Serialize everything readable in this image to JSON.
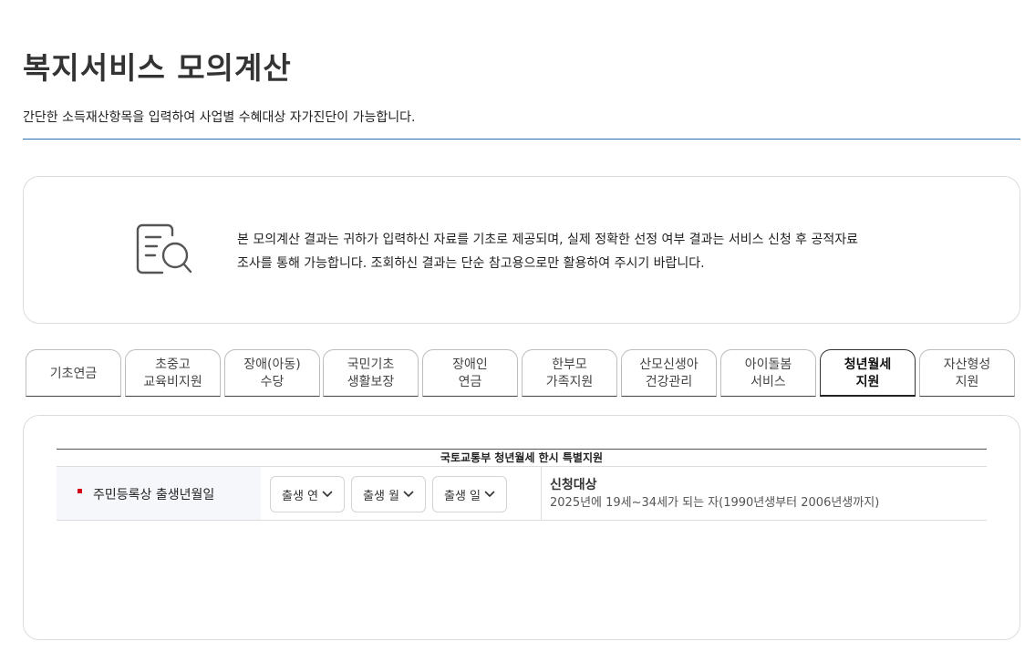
{
  "header": {
    "title": "복지서비스 모의계산",
    "description": "간단한 소득재산항목을 입력하여 사업별 수혜대상 자가진단이 가능합니다."
  },
  "notice": {
    "line1": "본 모의계산 결과는 귀하가 입력하신 자료를 기초로 제공되며, 실제 정확한 선정 여부 결과는 서비스 신청 후 공적자료",
    "line2": "조사를 통해 가능합니다. 조회하신 결과는 단순 참고용으로만 활용하여 주시기 바랍니다.",
    "icon": "document-search-icon"
  },
  "tabs": [
    {
      "label": "기초연금",
      "active": false
    },
    {
      "label": "초중고\n교육비지원",
      "active": false
    },
    {
      "label": "장애(아동)\n수당",
      "active": false
    },
    {
      "label": "국민기초\n생활보장",
      "active": false
    },
    {
      "label": "장애인\n연금",
      "active": false
    },
    {
      "label": "한부모\n가족지원",
      "active": false
    },
    {
      "label": "산모신생아\n건강관리",
      "active": false
    },
    {
      "label": "아이돌봄\n서비스",
      "active": false
    },
    {
      "label": "청년월세\n지원",
      "active": true
    },
    {
      "label": "자산형성\n지원",
      "active": false
    }
  ],
  "form": {
    "caption": "국토교통부 청년월세 한시 특별지원",
    "row": {
      "label": "주민등록상 출생년월일",
      "selects": [
        {
          "value": "출생 연"
        },
        {
          "value": "출생 월"
        },
        {
          "value": "출생 일"
        }
      ],
      "info_title": "신청대상",
      "info_desc": "2025년에 19세~34세가 되는 자(1990년생부터 2006년생까지)"
    }
  },
  "colors": {
    "accent_rule": "#2a6db5",
    "required_mark": "#d4001a",
    "row_head_bg": "#f5f7fb"
  }
}
